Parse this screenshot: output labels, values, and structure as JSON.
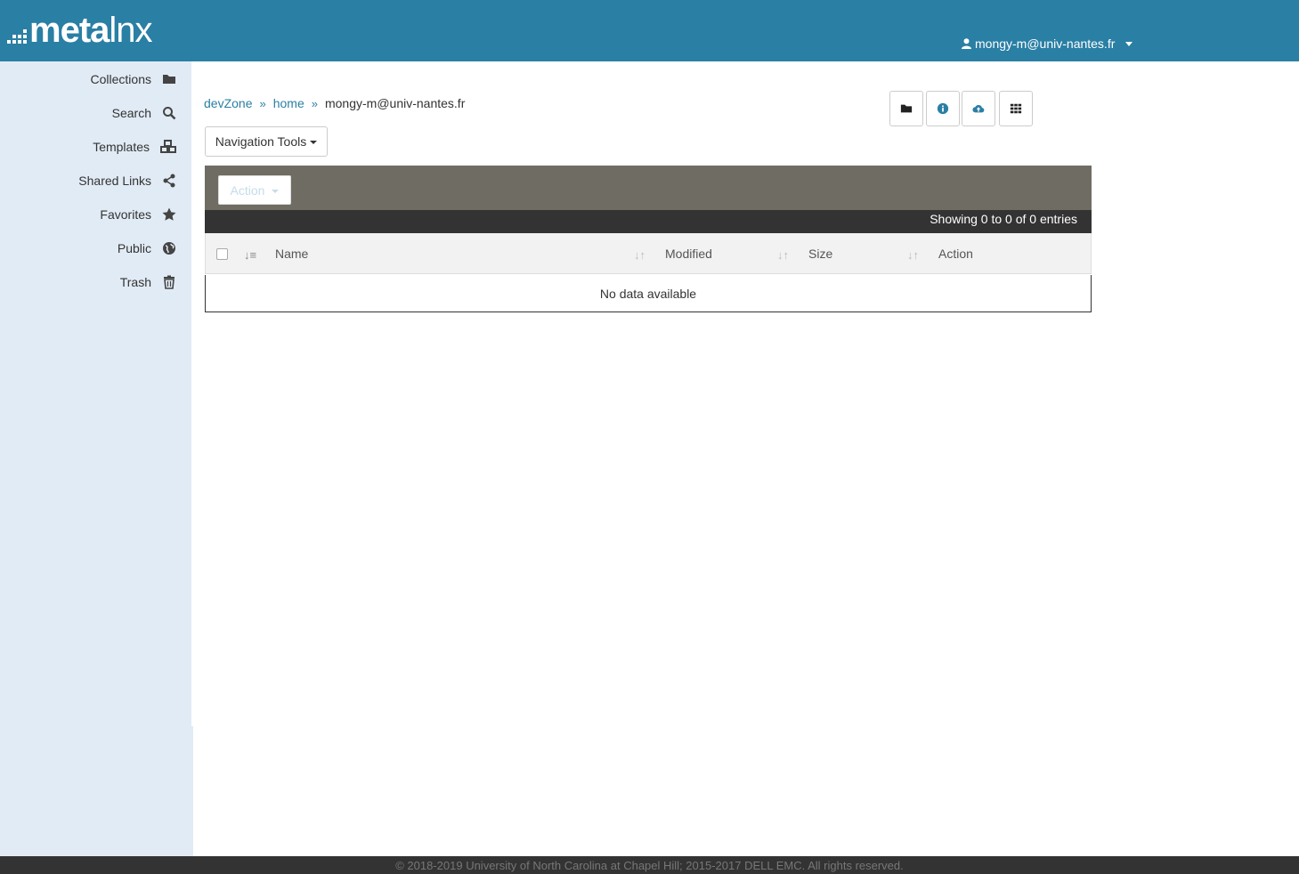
{
  "brand": {
    "logo_bold": "meta",
    "logo_light": "lnx"
  },
  "header": {
    "user_email": "mongy-m@univ-nantes.fr",
    "user_icon": "user-icon"
  },
  "sidebar": {
    "items": [
      {
        "label": "Collections",
        "icon": "folder-icon"
      },
      {
        "label": "Search",
        "icon": "search-icon"
      },
      {
        "label": "Templates",
        "icon": "cubes-icon"
      },
      {
        "label": "Shared Links",
        "icon": "share-icon"
      },
      {
        "label": "Favorites",
        "icon": "star-icon"
      },
      {
        "label": "Public",
        "icon": "globe-icon"
      },
      {
        "label": "Trash",
        "icon": "trash-icon"
      }
    ]
  },
  "breadcrumb": {
    "items": [
      "devZone",
      "home"
    ],
    "current": "mongy-m@univ-nantes.fr"
  },
  "toolbar": {
    "buttons": [
      "folder-icon",
      "info-icon",
      "cloud-upload-icon",
      "grid-icon"
    ],
    "accent": "#2a7fa4"
  },
  "navigation_tools": {
    "label": "Navigation Tools"
  },
  "panel": {
    "action_label": "Action",
    "info_text": "Showing 0 to 0 of 0 entries"
  },
  "table": {
    "columns": [
      "Name",
      "Modified",
      "Size",
      "Action"
    ],
    "empty_text": "No data available"
  },
  "footer": {
    "copyright": "© 2018-2019 University of North Carolina at Chapel Hill; 2015-2017 DELL EMC. All rights reserved."
  },
  "colors": {
    "topbar": "#2a7fa4",
    "sidebar": "#e1ebf5",
    "panel_head": "#6f6d63",
    "info_bar": "#333333"
  }
}
